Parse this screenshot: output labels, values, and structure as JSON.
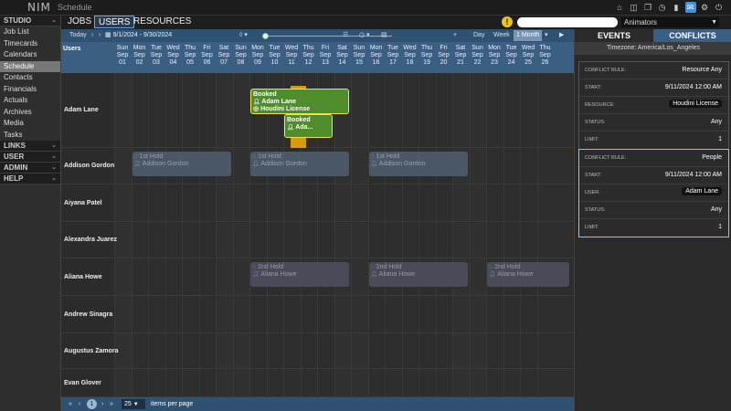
{
  "app": {
    "logo": "NIM",
    "page": "Schedule"
  },
  "nav": {
    "tabs": [
      "JOBS",
      "USERS",
      "RESOURCES"
    ],
    "active_tab": "USERS"
  },
  "search": {
    "placeholder": ""
  },
  "group_select": {
    "value": "Animators"
  },
  "top_icons": [
    "home-icon",
    "layers-icon",
    "copy-icon",
    "clock-icon",
    "bookmark-icon",
    "mail-icon",
    "gear-icon",
    "power-icon"
  ],
  "sidebar": {
    "sections": [
      {
        "label": "STUDIO",
        "items": [
          "Job List",
          "Timecards",
          "Calendars",
          "Schedule",
          "Contacts",
          "Financials",
          "Actuals",
          "Archives",
          "Media",
          "Tasks"
        ],
        "active": "Schedule"
      },
      {
        "label": "LINKS",
        "items": []
      },
      {
        "label": "USER",
        "items": []
      },
      {
        "label": "ADMIN",
        "items": []
      },
      {
        "label": "HELP",
        "items": []
      }
    ]
  },
  "toolbar": {
    "today": "Today",
    "range": "9/1/2024 - 9/30/2024",
    "views": [
      "Day",
      "Week",
      "1 Month"
    ],
    "active_view": "1 Month",
    "add": "+"
  },
  "grid": {
    "users_header": "Users",
    "days": [
      {
        "dow": "Sun",
        "mon": "Sep",
        "d": "01"
      },
      {
        "dow": "Mon",
        "mon": "Sep",
        "d": "02"
      },
      {
        "dow": "Tue",
        "mon": "Sep",
        "d": "03"
      },
      {
        "dow": "Wed",
        "mon": "Sep",
        "d": "04"
      },
      {
        "dow": "Thu",
        "mon": "Sep",
        "d": "05"
      },
      {
        "dow": "Fri",
        "mon": "Sep",
        "d": "06"
      },
      {
        "dow": "Sat",
        "mon": "Sep",
        "d": "07"
      },
      {
        "dow": "Sun",
        "mon": "Sep",
        "d": "08"
      },
      {
        "dow": "Mon",
        "mon": "Sep",
        "d": "09"
      },
      {
        "dow": "Tue",
        "mon": "Sep",
        "d": "10"
      },
      {
        "dow": "Wed",
        "mon": "Sep",
        "d": "11"
      },
      {
        "dow": "Thu",
        "mon": "Sep",
        "d": "12"
      },
      {
        "dow": "Fri",
        "mon": "Sep",
        "d": "13"
      },
      {
        "dow": "Sat",
        "mon": "Sep",
        "d": "14"
      },
      {
        "dow": "Sun",
        "mon": "Sep",
        "d": "15"
      },
      {
        "dow": "Mon",
        "mon": "Sep",
        "d": "16"
      },
      {
        "dow": "Tue",
        "mon": "Sep",
        "d": "17"
      },
      {
        "dow": "Wed",
        "mon": "Sep",
        "d": "18"
      },
      {
        "dow": "Thu",
        "mon": "Sep",
        "d": "19"
      },
      {
        "dow": "Fri",
        "mon": "Sep",
        "d": "20"
      },
      {
        "dow": "Sat",
        "mon": "Sep",
        "d": "21"
      },
      {
        "dow": "Sun",
        "mon": "Sep",
        "d": "22"
      },
      {
        "dow": "Mon",
        "mon": "Sep",
        "d": "23"
      },
      {
        "dow": "Tue",
        "mon": "Sep",
        "d": "24"
      },
      {
        "dow": "Wed",
        "mon": "Sep",
        "d": "25"
      },
      {
        "dow": "Thu",
        "mon": "Sep",
        "d": "26"
      }
    ],
    "users": [
      "Adam Lane",
      "Addison Gordon",
      "Aiyana Patel",
      "Alexandra Juarez",
      "Aliana Howe",
      "Andrew Sinagra",
      "Augustus Zamora",
      "Evan Glover"
    ],
    "events": [
      {
        "user": 0,
        "start": 8,
        "end": 13,
        "row_slot": 0,
        "status": "Booked",
        "person": "Adam Lane",
        "resource": "Houdini License",
        "kind": "booked"
      },
      {
        "user": 0,
        "start": 10,
        "end": 12,
        "row_slot": 1,
        "status": "Booked",
        "person": "Ada...",
        "resource": "",
        "kind": "booked"
      },
      {
        "user": 1,
        "start": 1,
        "end": 6,
        "row_slot": 0,
        "status": "1st Hold",
        "person": "Addison Gordon",
        "resource": "",
        "kind": "hold"
      },
      {
        "user": 1,
        "start": 8,
        "end": 13,
        "row_slot": 0,
        "status": "1st Hold",
        "person": "Addison Gordon",
        "resource": "",
        "kind": "hold"
      },
      {
        "user": 1,
        "start": 15,
        "end": 20,
        "row_slot": 0,
        "status": "1st Hold",
        "person": "Addison Gordon",
        "resource": "",
        "kind": "hold"
      },
      {
        "user": 4,
        "start": 8,
        "end": 13,
        "row_slot": 0,
        "status": "2nd Hold",
        "person": "Aliana Howe",
        "resource": "",
        "kind": "hold2"
      },
      {
        "user": 4,
        "start": 15,
        "end": 20,
        "row_slot": 0,
        "status": "2nd Hold",
        "person": "Aliana Howe",
        "resource": "",
        "kind": "hold2"
      },
      {
        "user": 4,
        "start": 22,
        "end": 26,
        "row_slot": 0,
        "status": "2nd Hold",
        "person": "Aliana Howe",
        "resource": "",
        "kind": "hold2"
      }
    ]
  },
  "pagination": {
    "page": "1",
    "page_size": "25",
    "label": "items per page"
  },
  "panel": {
    "tabs": [
      "EVENTS",
      "CONFLICTS"
    ],
    "active_tab": "CONFLICTS",
    "timezone": "Timezone: America/Los_Angeles",
    "conflicts": [
      {
        "rows": [
          {
            "key": "Conflict Rule:",
            "value": "Resource Any",
            "pill": false
          },
          {
            "key": "Start:",
            "value": "9/11/2024 12:00 AM",
            "pill": false
          },
          {
            "key": "Resource:",
            "value": "Houdini License",
            "pill": true
          },
          {
            "key": "Status:",
            "value": "Any",
            "pill": false
          },
          {
            "key": "Limit:",
            "value": "1",
            "pill": false
          }
        ],
        "selected": false
      },
      {
        "rows": [
          {
            "key": "Conflict Rule:",
            "value": "People",
            "pill": false
          },
          {
            "key": "Start:",
            "value": "9/11/2024 12:00 AM",
            "pill": false
          },
          {
            "key": "User:",
            "value": "Adam Lane",
            "pill": true
          },
          {
            "key": "Status:",
            "value": "Any",
            "pill": false
          },
          {
            "key": "Limit:",
            "value": "1",
            "pill": false
          }
        ],
        "selected": true
      }
    ]
  }
}
